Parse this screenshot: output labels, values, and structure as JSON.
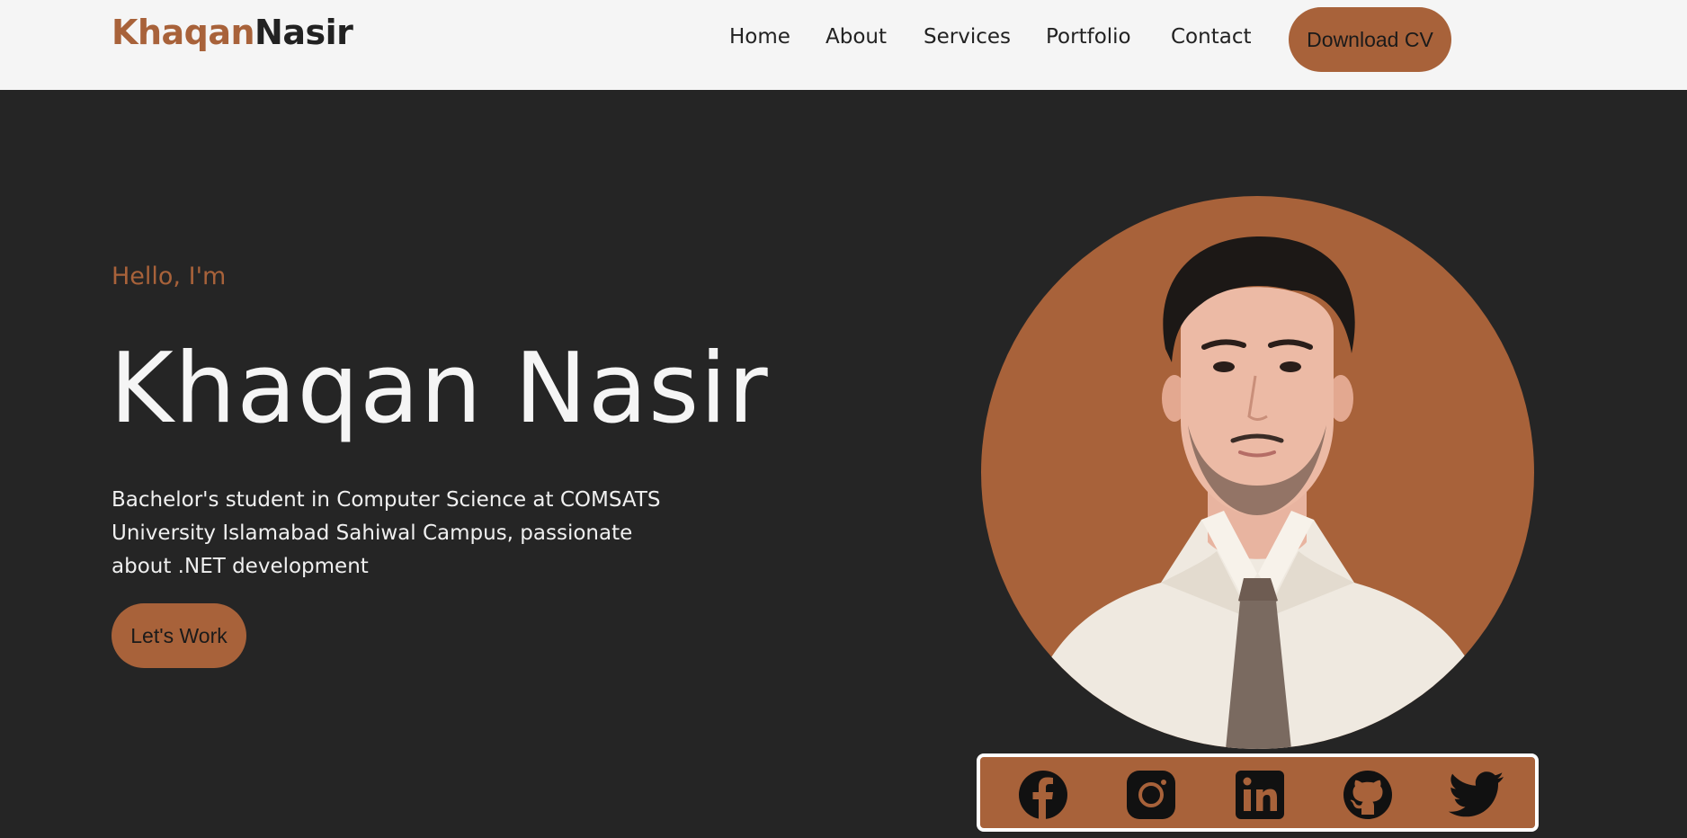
{
  "logo": {
    "part1": "Khaqan",
    "part2": "Nasir"
  },
  "nav": {
    "home": "Home",
    "about": "About",
    "services": "Services",
    "portfolio": "Portfolio",
    "contact": "Contact",
    "download_cv": "Download CV"
  },
  "hero": {
    "greeting": "Hello, I'm",
    "name": "Khaqan Nasir",
    "description": "Bachelor's student in Computer Science at COMSATS University Islamabad Sahiwal Campus, passionate about .NET development",
    "cta": "Let's Work"
  },
  "social_icons": [
    "facebook-icon",
    "instagram-icon",
    "linkedin-icon",
    "github-icon",
    "twitter-icon"
  ],
  "colors": {
    "accent": "#a8623a",
    "background": "#252525",
    "navbar": "#f5f5f5",
    "text_light": "#f5f5f5",
    "text_dark": "#222222"
  }
}
